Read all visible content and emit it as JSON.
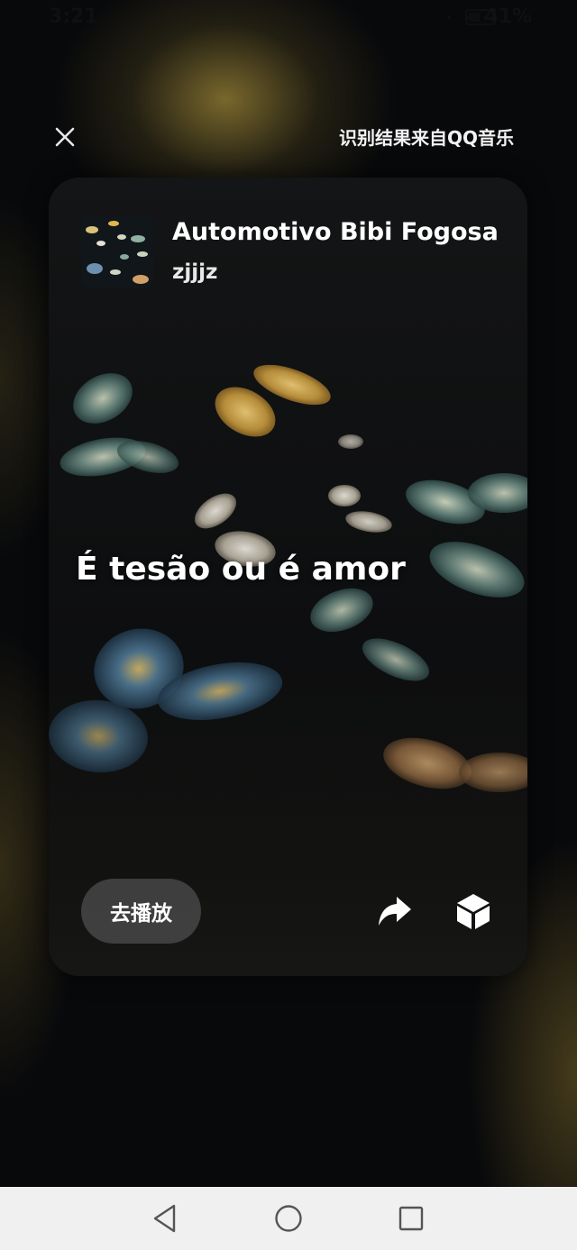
{
  "status_bar": {
    "time": "3:21",
    "signal_icons": "· · ·",
    "battery": "41%"
  },
  "header": {
    "source_label": "识别结果来自QQ音乐"
  },
  "song": {
    "title": "Automotivo Bibi Fogosa",
    "artist": "zjjjz"
  },
  "lyric": {
    "current_line": "É tesão ou é amor"
  },
  "actions": {
    "play_label": "去播放"
  },
  "colors": {
    "background": "#08090b",
    "card": "#121314",
    "play_button": "#464648",
    "nav_bar": "#f0f0f0"
  },
  "icons": [
    "close-icon",
    "share-icon",
    "cube-icon",
    "back-icon",
    "home-icon",
    "recent-apps-icon"
  ]
}
